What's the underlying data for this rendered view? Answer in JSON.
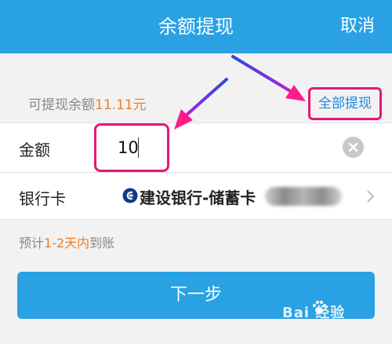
{
  "header": {
    "title": "余额提现",
    "cancel_label": "取消"
  },
  "balance": {
    "label": "可提现余额",
    "amount": "11.11元",
    "withdraw_all_label": "全部提现"
  },
  "form": {
    "amount_label": "金额",
    "amount_value": "10",
    "bank_card_label": "银行卡",
    "bank_card_value": "建设银行-储蓄卡"
  },
  "eta": {
    "prefix": "预计",
    "highlight": "1-2天内",
    "suffix": "到账"
  },
  "next_button_label": "下一步",
  "watermark": "Bai 经验",
  "colors": {
    "header_bg": "#29a1e3",
    "accent_orange": "#ef7d22",
    "link_blue": "#1e88e5",
    "highlight_pink": "#e5177a"
  },
  "icons": {
    "clear": "clear-circle-icon",
    "bank": "ccb-bank-logo-icon",
    "chevron": "chevron-right-icon",
    "arrow": "annotation-arrow-icon"
  }
}
